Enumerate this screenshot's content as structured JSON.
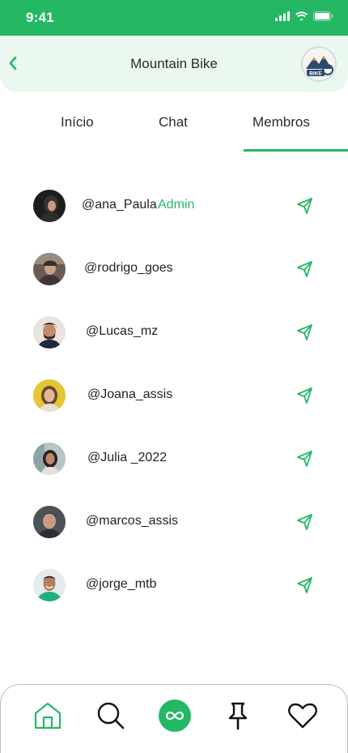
{
  "status_bar": {
    "time": "9:41"
  },
  "header": {
    "title": "Mountain Bike",
    "group_logo_text": "BIKE"
  },
  "tabs": [
    {
      "label": "Início",
      "active": false
    },
    {
      "label": "Chat",
      "active": false
    },
    {
      "label": "Membros",
      "active": true
    }
  ],
  "members": [
    {
      "username": "@ana_Paula",
      "badge": "Admin",
      "avatar_color": "#2a2a2a"
    },
    {
      "username": "@rodrigo_goes",
      "badge": "",
      "avatar_color": "#5a4a44"
    },
    {
      "username": "@Lucas_mz",
      "badge": "",
      "avatar_color": "#7a5a48"
    },
    {
      "username": "@Joana_assis",
      "badge": "",
      "avatar_color": "#e7c33a"
    },
    {
      "username": "@Julia _2022",
      "badge": "",
      "avatar_color": "#a9b4b8"
    },
    {
      "username": "@marcos_assis",
      "badge": "",
      "avatar_color": "#4a4f55"
    },
    {
      "username": "@jorge_mtb",
      "badge": "",
      "avatar_color": "#dfe6ea"
    }
  ],
  "bottom_nav": {
    "items": [
      {
        "icon": "home-icon",
        "active": true
      },
      {
        "icon": "search-icon",
        "active": false
      },
      {
        "icon": "infinity-icon",
        "active": false
      },
      {
        "icon": "pin-icon",
        "active": false
      },
      {
        "icon": "heart-icon",
        "active": false
      }
    ]
  },
  "colors": {
    "accent": "#25b864",
    "header_bg": "#eaf8ef"
  }
}
